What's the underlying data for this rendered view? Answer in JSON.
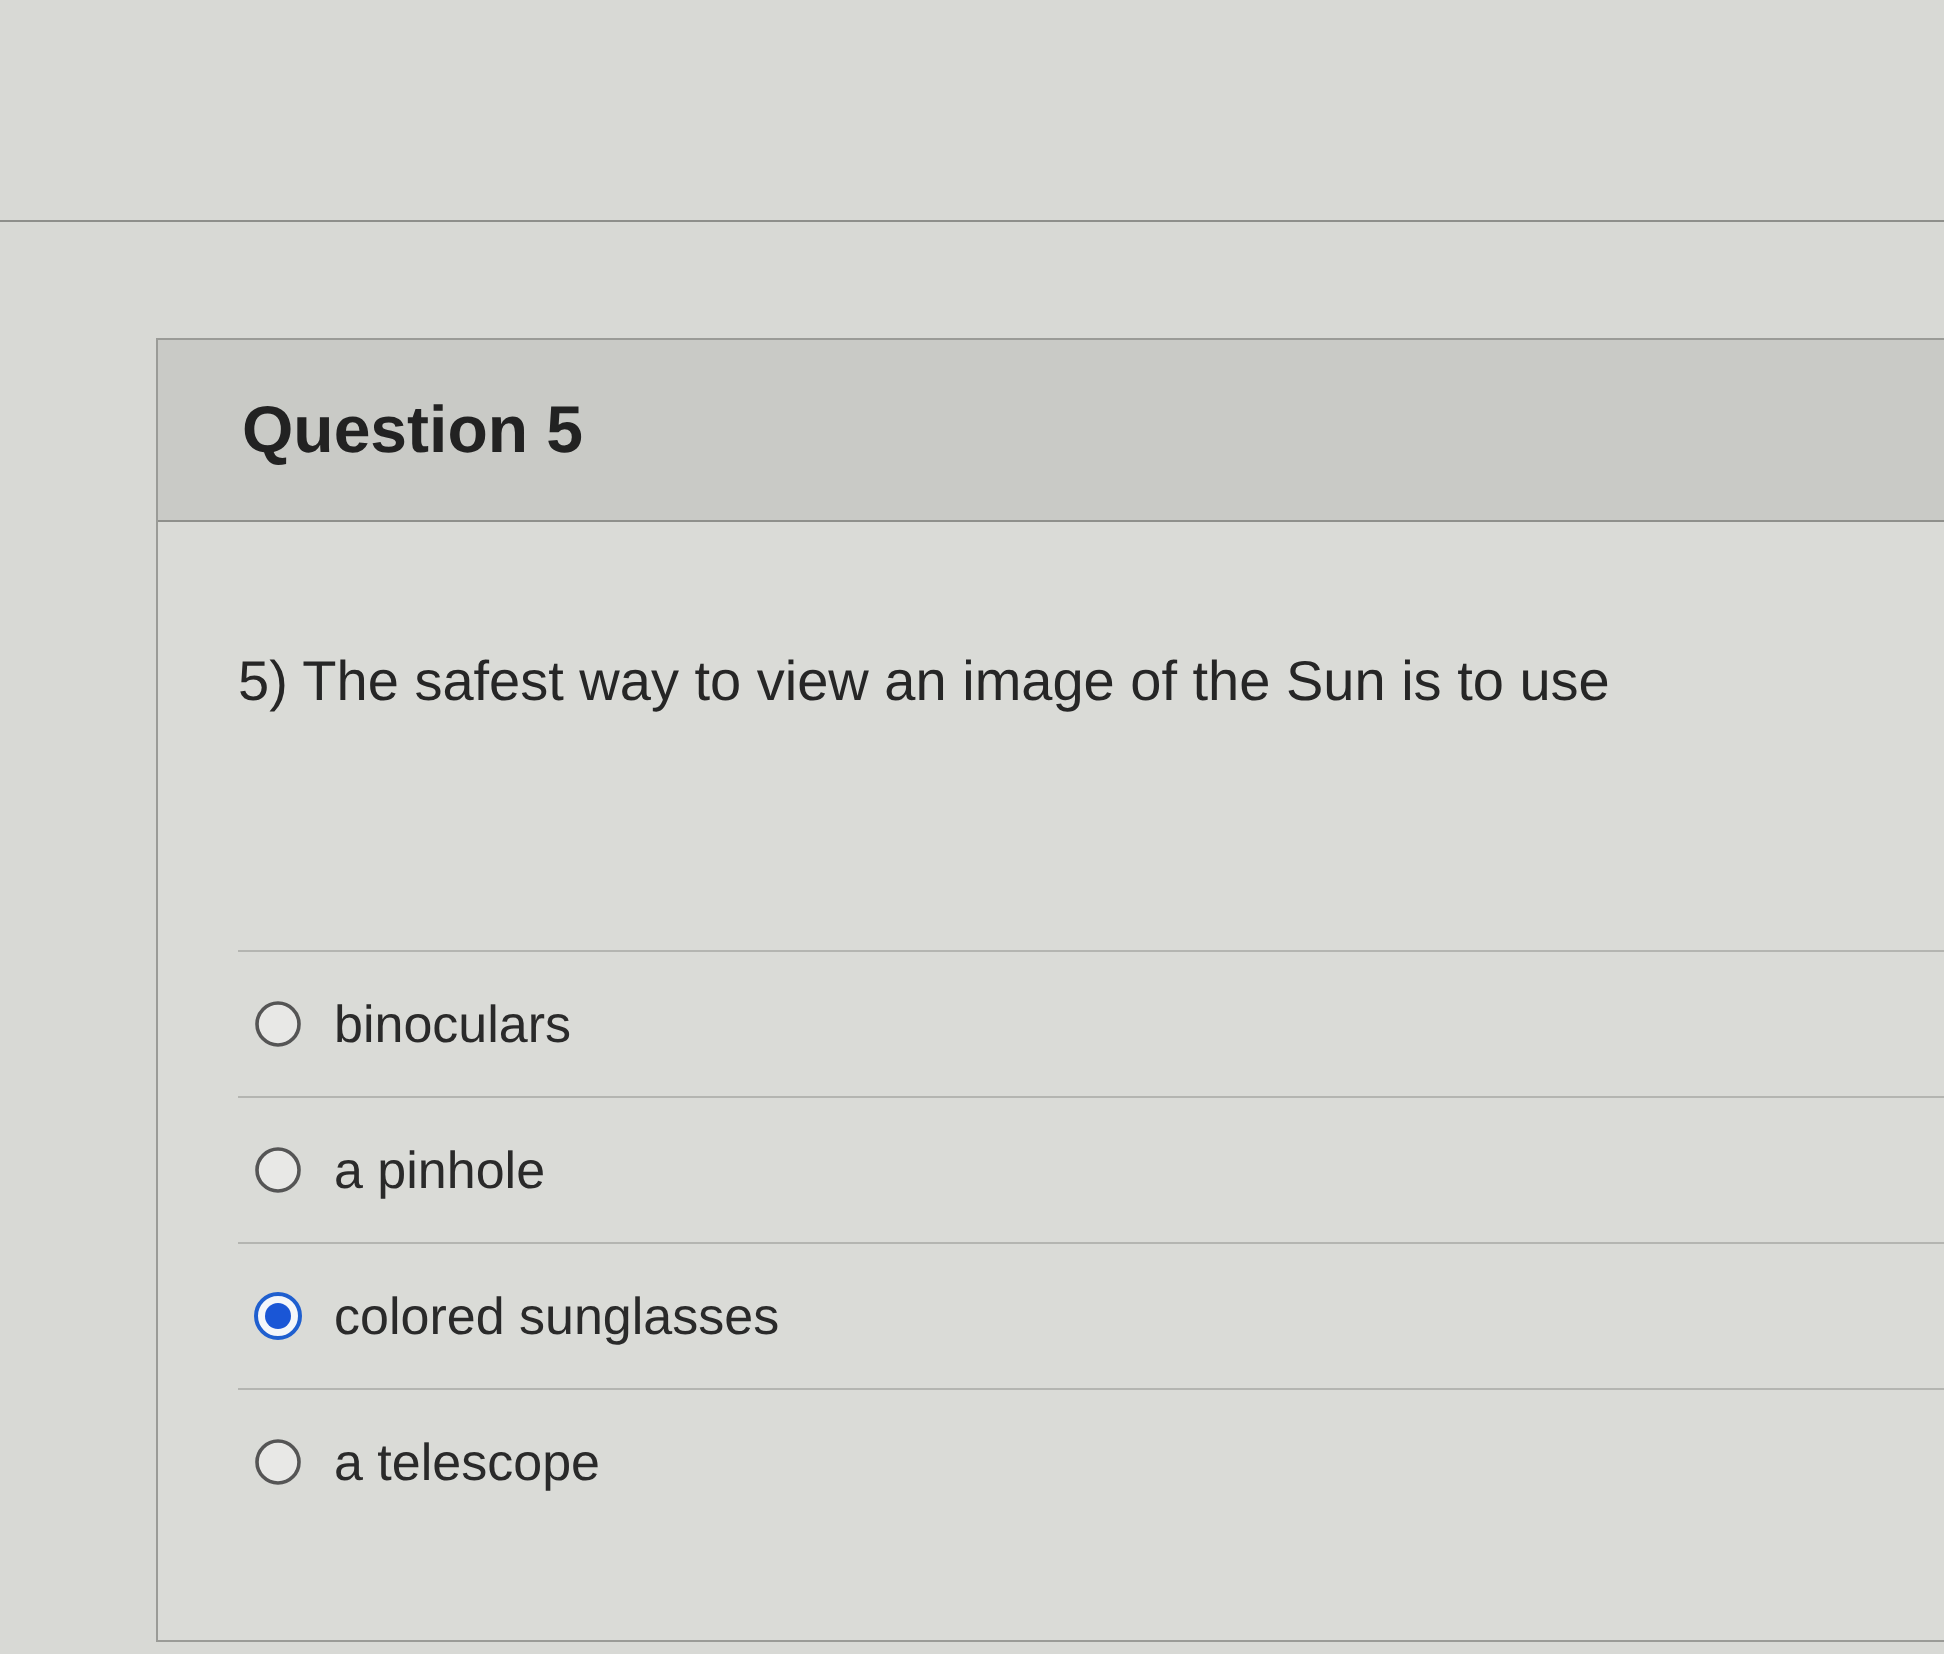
{
  "question": {
    "title": "Question 5",
    "text": "5) The safest way to view an image of the Sun is to use",
    "answers": [
      {
        "label": "binoculars",
        "selected": false
      },
      {
        "label": "a pinhole",
        "selected": false
      },
      {
        "label": "colored sunglasses",
        "selected": true
      },
      {
        "label": "a telescope",
        "selected": false
      }
    ]
  }
}
